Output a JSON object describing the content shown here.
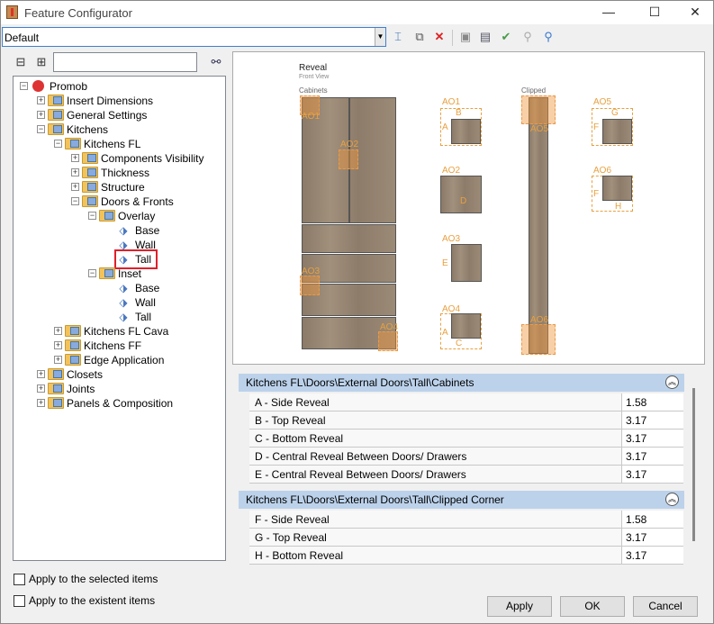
{
  "window": {
    "title": "Feature Configurator",
    "minimize": "—",
    "maximize": "☐",
    "close": "✕"
  },
  "toolbar": {
    "profile_value": "Default"
  },
  "tree": {
    "items": [
      {
        "label": "Promob",
        "level": 0,
        "icon": "promob-icon",
        "exp": "−"
      },
      {
        "label": "Insert Dimensions",
        "level": 1,
        "icon": "folder-icon",
        "exp": "+"
      },
      {
        "label": "General Settings",
        "level": 1,
        "icon": "folder-icon",
        "exp": "+"
      },
      {
        "label": "Kitchens",
        "level": 1,
        "icon": "folder-icon",
        "exp": "−"
      },
      {
        "label": "Kitchens FL",
        "level": 2,
        "icon": "folder-icon",
        "exp": "−"
      },
      {
        "label": "Components Visibility",
        "level": 3,
        "icon": "folder-icon",
        "exp": "+"
      },
      {
        "label": "Thickness",
        "level": 3,
        "icon": "folder-icon",
        "exp": "+"
      },
      {
        "label": "Structure",
        "level": 3,
        "icon": "folder-icon",
        "exp": "+"
      },
      {
        "label": "Doors & Fronts",
        "level": 3,
        "icon": "folder-icon",
        "exp": "−"
      },
      {
        "label": "Overlay",
        "level": 4,
        "icon": "folder-icon",
        "exp": "−"
      },
      {
        "label": "Base",
        "level": 5,
        "icon": "tag-icon",
        "exp": ""
      },
      {
        "label": "Wall",
        "level": 5,
        "icon": "tag-icon",
        "exp": ""
      },
      {
        "label": "Tall",
        "level": 5,
        "icon": "tag-icon",
        "exp": ""
      },
      {
        "label": "Inset",
        "level": 4,
        "icon": "folder-icon",
        "exp": "−"
      },
      {
        "label": "Base",
        "level": 5,
        "icon": "tag-icon",
        "exp": ""
      },
      {
        "label": "Wall",
        "level": 5,
        "icon": "tag-icon",
        "exp": ""
      },
      {
        "label": "Tall",
        "level": 5,
        "icon": "tag-icon",
        "exp": ""
      },
      {
        "label": "Kitchens FL Cava",
        "level": 2,
        "icon": "folder-icon",
        "exp": "+"
      },
      {
        "label": "Kitchens FF",
        "level": 2,
        "icon": "folder-icon",
        "exp": "+"
      },
      {
        "label": "Edge Application",
        "level": 2,
        "icon": "folder-icon",
        "exp": "+"
      },
      {
        "label": "Closets",
        "level": 1,
        "icon": "folder-icon",
        "exp": "+"
      },
      {
        "label": "Joints",
        "level": 1,
        "icon": "folder-icon",
        "exp": "+"
      },
      {
        "label": "Panels & Composition",
        "level": 1,
        "icon": "folder-icon",
        "exp": "+"
      }
    ],
    "selected_index": 12
  },
  "preview": {
    "title": "Reveal",
    "subtitle": "Front View",
    "cabinets_label": "Cabinets",
    "clipped_label": "Clipped",
    "markers": [
      "AO1",
      "AO2",
      "AO3",
      "AO4",
      "AO5",
      "AO6"
    ],
    "detail_letters": [
      "A",
      "B",
      "C",
      "D",
      "E",
      "F",
      "G",
      "H"
    ]
  },
  "sections": [
    {
      "title": "Kitchens FL\\Doors\\External Doors\\Tall\\Cabinets",
      "collapse_icon": "︽",
      "rows": [
        {
          "label": "A - Side Reveal",
          "value": "1.58"
        },
        {
          "label": "B - Top Reveal",
          "value": "3.17"
        },
        {
          "label": "C - Bottom Reveal",
          "value": "3.17"
        },
        {
          "label": "D - Central Reveal Between Doors/ Drawers",
          "value": "3.17"
        },
        {
          "label": "E - Central Reveal Between Doors/ Drawers",
          "value": "3.17"
        }
      ]
    },
    {
      "title": "Kitchens FL\\Doors\\External Doors\\Tall\\Clipped Corner",
      "collapse_icon": "︽",
      "rows": [
        {
          "label": "F - Side Reveal",
          "value": "1.58"
        },
        {
          "label": "G - Top Reveal",
          "value": "3.17"
        },
        {
          "label": "H - Bottom Reveal",
          "value": "3.17"
        }
      ]
    }
  ],
  "options": {
    "apply_selected": "Apply to the selected items",
    "apply_existent": "Apply to the existent items"
  },
  "buttons": {
    "apply": "Apply",
    "ok": "OK",
    "cancel": "Cancel"
  }
}
